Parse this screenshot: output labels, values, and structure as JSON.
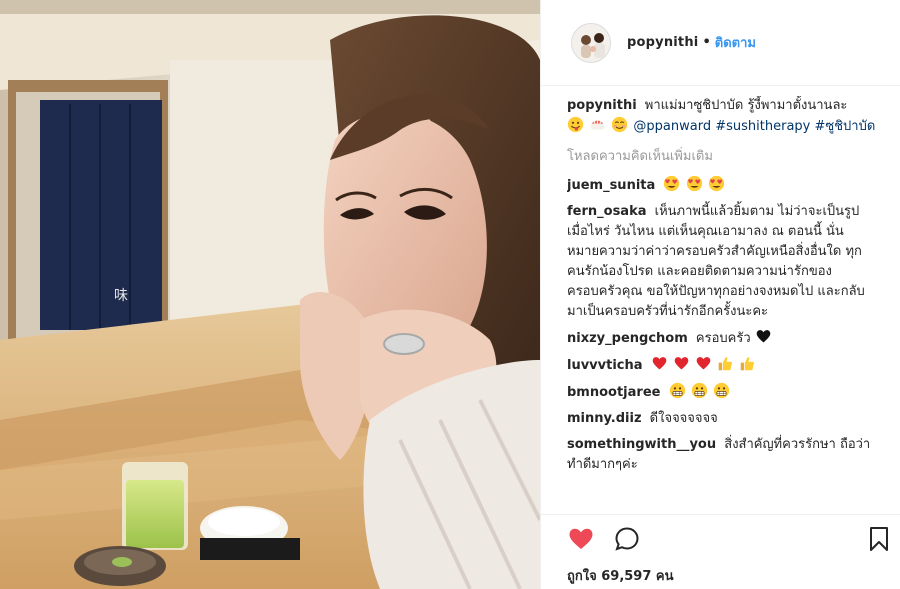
{
  "header": {
    "username": "popynithi",
    "separator": "•",
    "follow_label": "ติดตาม"
  },
  "caption": {
    "username": "popynithi",
    "text": "พาแม่มาซูชิปาบัด รู้งี้พามาตั้งนานละ",
    "emojis": [
      "grin-tongue",
      "sushi",
      "smile-blush"
    ],
    "mention": "@ppanward",
    "hashtag1": "#sushitherapy",
    "hashtag2": "#ซูชิปาบัด"
  },
  "load_more_label": "โหลดความคิดเห็นเพิ่มเติม",
  "comments": [
    {
      "username": "juem_sunita",
      "text": "",
      "emojis": [
        "heart-eyes",
        "heart-eyes",
        "heart-eyes"
      ]
    },
    {
      "username": "fern_osaka",
      "text": "เห็นภาพนี้แล้วยิ้มตาม ไม่ว่าจะเป็นรูปเมื่อไหร่ วันไหน แต่เห็นคุณเอามาลง ณ ตอนนี้ นั่นหมายความว่าค่าว่าครอบครัวสำคัญเหนือสิ่งอื่นใด ทุกคนรักน้องโปรด และคอยติดตามความน่ารักของครอบครัวคุณ ขอให้ปัญหาทุกอย่างจงหมดไป และกลับมาเป็นครอบครัวที่น่ารักอีกครั้งนะคะ",
      "emojis": []
    },
    {
      "username": "nixzy_pengchom",
      "text": "ครอบครัว",
      "emojis": [
        "black-heart"
      ]
    },
    {
      "username": "luvvvticha",
      "text": "",
      "emojis": [
        "red-heart",
        "red-heart",
        "red-heart",
        "thumbs-up",
        "thumbs-up"
      ]
    },
    {
      "username": "bmnootjaree",
      "text": "",
      "emojis": [
        "grimace",
        "grimace",
        "grimace"
      ]
    },
    {
      "username": "minny.diiz",
      "text": "ดีใจจจจจจจ",
      "emojis": []
    },
    {
      "username": "somethingwith__you",
      "text": "สิ่งสำคัญที่ควรรักษา ถือว่าทำดีมากๆค่ะ",
      "emojis": []
    }
  ],
  "likes": {
    "label": "ถูกใจ 69,597 คน"
  },
  "colors": {
    "like_red": "#ed4956",
    "link_blue": "#003569",
    "follow_blue": "#3897f0",
    "muted_gray": "#999999"
  },
  "icons": [
    "heart-icon",
    "comment-icon",
    "bookmark-icon"
  ]
}
